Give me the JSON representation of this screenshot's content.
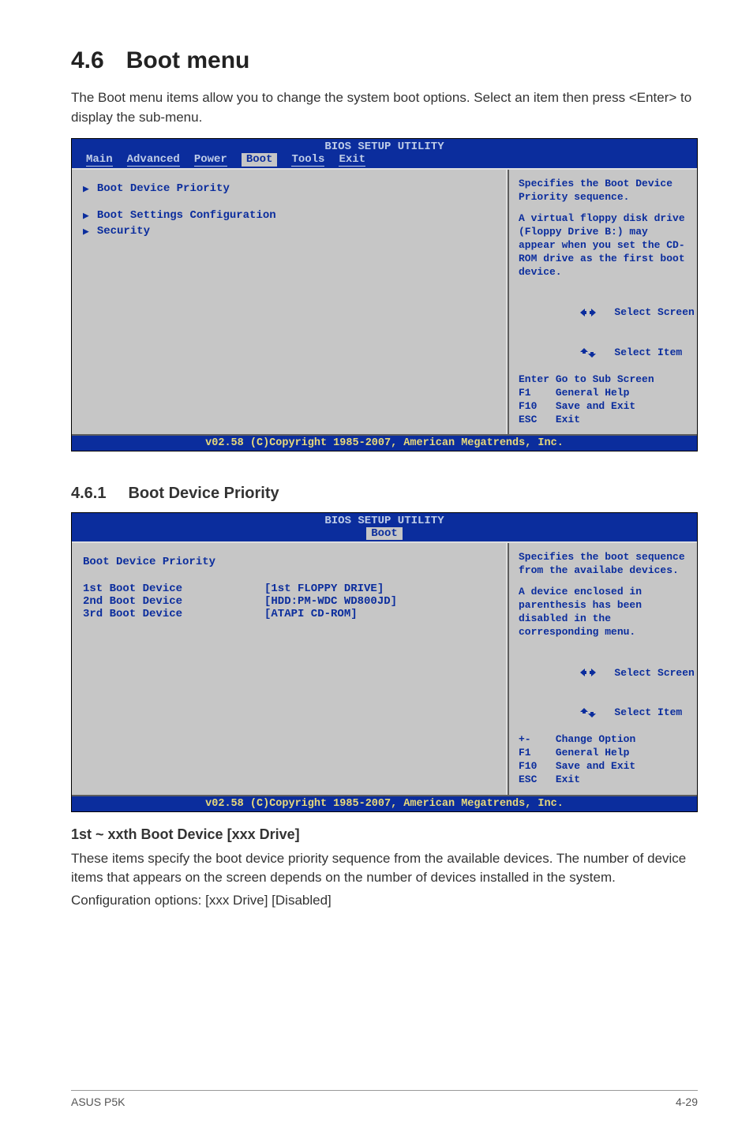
{
  "section": {
    "number": "4.6",
    "title": "Boot menu"
  },
  "intro": "The Boot menu items allow you to change the system boot options. Select an item then press <Enter> to display the sub-menu.",
  "bios1": {
    "title": "BIOS SETUP UTILITY",
    "menu": {
      "main": "Main",
      "advanced": "Advanced",
      "power": "Power",
      "boot": "Boot",
      "tools": "Tools",
      "exit": "Exit"
    },
    "items": {
      "boot_device_priority": "Boot Device Priority",
      "boot_settings_configuration": "Boot Settings Configuration",
      "security": "Security"
    },
    "help": {
      "p1": "Specifies the Boot Device Priority sequence.",
      "p2": "A virtual floppy disk drive (Floppy Drive B:) may appear when you set the CD-ROM drive as the first boot device.",
      "keys": {
        "select_screen": "Select Screen",
        "select_item": "Select Item",
        "enter_label": "Enter",
        "enter_action": "Go to Sub Screen",
        "f1_label": "F1",
        "f1_action": "General Help",
        "f10_label": "F10",
        "f10_action": "Save and Exit",
        "esc_label": "ESC",
        "esc_action": "Exit"
      }
    },
    "footer": "v02.58 (C)Copyright 1985-2007, American Megatrends, Inc."
  },
  "subsection": {
    "number": "4.6.1",
    "title": "Boot Device Priority"
  },
  "bios2": {
    "title": "BIOS SETUP UTILITY",
    "menu": {
      "boot": "Boot"
    },
    "heading": "Boot Device Priority",
    "rows": {
      "r1": {
        "label": "1st Boot Device",
        "value": "[1st FLOPPY DRIVE]"
      },
      "r2": {
        "label": "2nd Boot Device",
        "value": "[HDD:PM-WDC WD800JD]"
      },
      "r3": {
        "label": "3rd Boot Device",
        "value": "[ATAPI CD-ROM]"
      }
    },
    "help": {
      "p1": "Specifies the boot sequence from the availabe devices.",
      "p2": "A device enclosed in parenthesis has been disabled in the corresponding menu.",
      "keys": {
        "select_screen": "Select Screen",
        "select_item": "Select Item",
        "pm_label": "+-",
        "pm_action": "Change Option",
        "f1_label": "F1",
        "f1_action": "General Help",
        "f10_label": "F10",
        "f10_action": "Save and Exit",
        "esc_label": "ESC",
        "esc_action": "Exit"
      }
    },
    "footer": "v02.58 (C)Copyright 1985-2007, American Megatrends, Inc."
  },
  "subheading": "1st ~ xxth Boot Device [xxx Drive]",
  "body1": "These items specify the boot device priority sequence from the available devices. The number of device items that appears on the screen depends on the number of devices installed in the system.",
  "body2": "Configuration options: [xxx Drive] [Disabled]",
  "footer": {
    "left": "ASUS P5K",
    "right": "4-29"
  }
}
